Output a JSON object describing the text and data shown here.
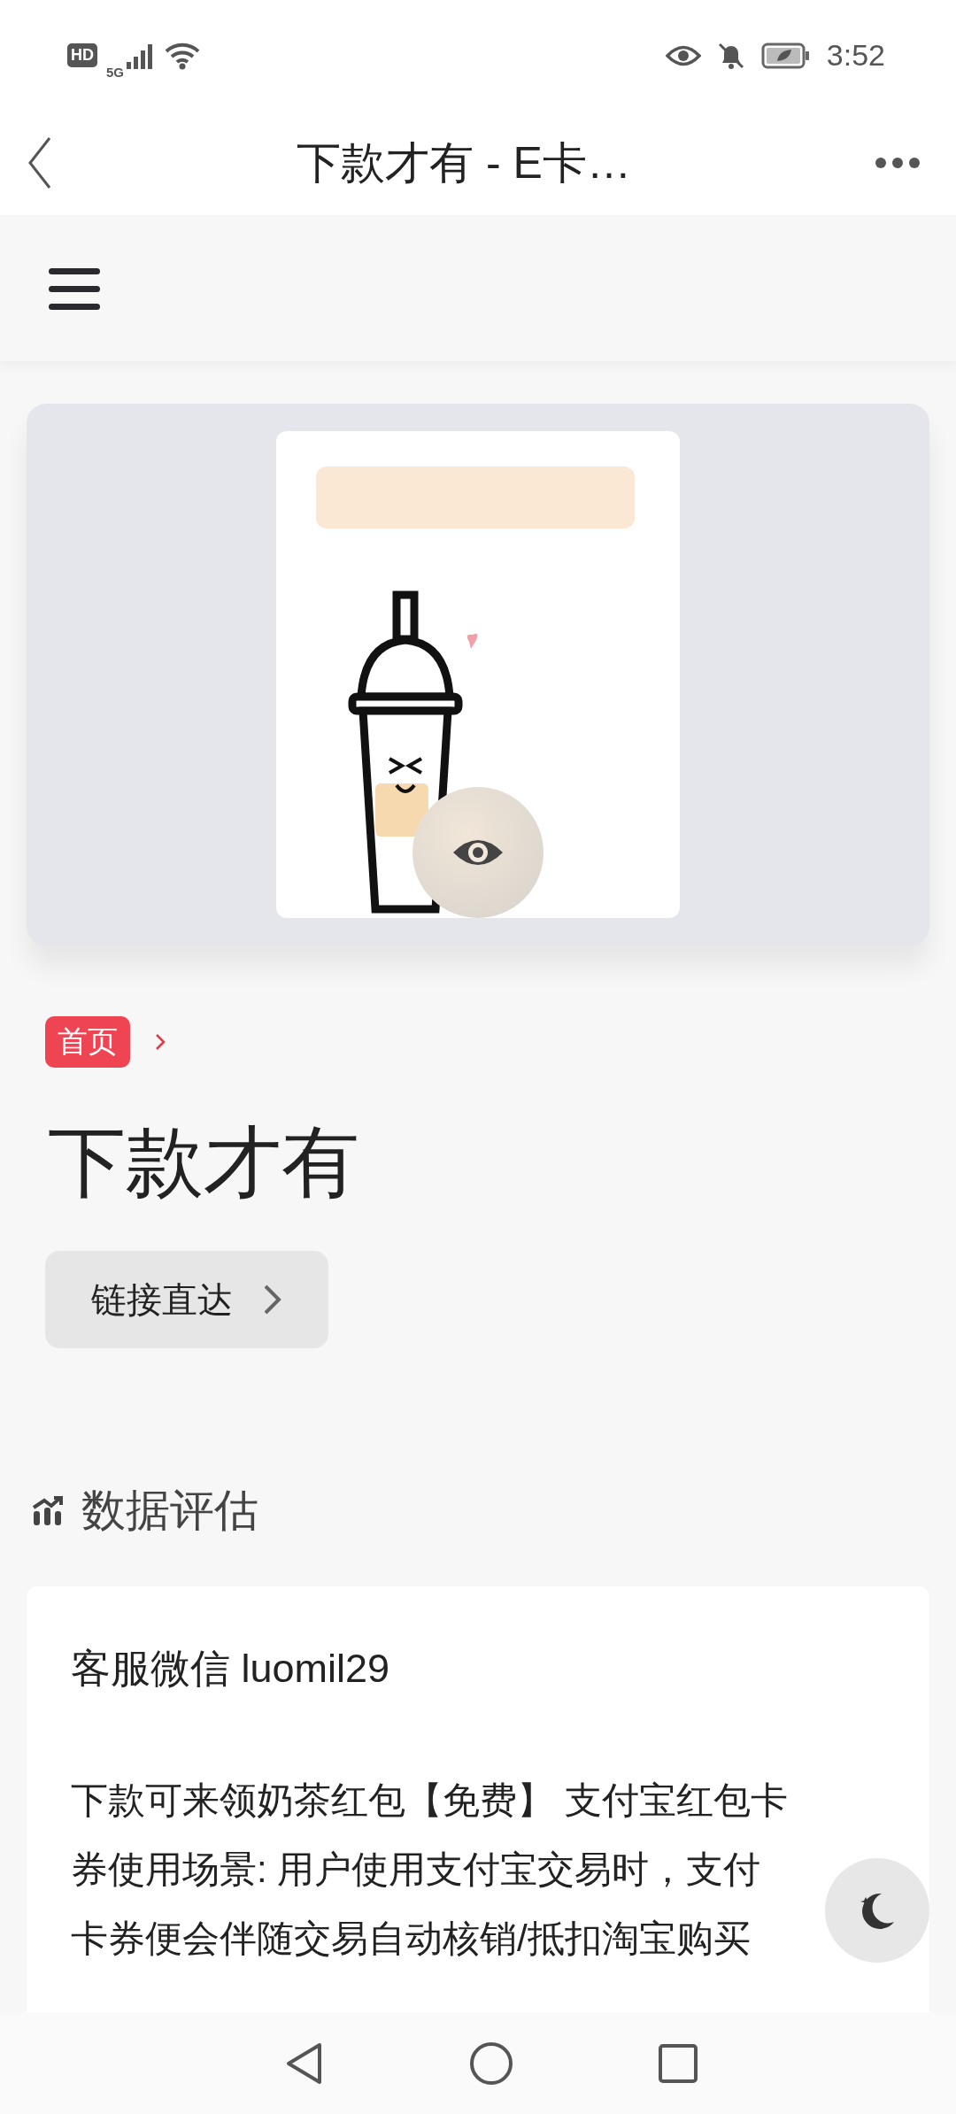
{
  "status_bar": {
    "hd": "HD",
    "network": "5G",
    "time": "3:52"
  },
  "nav": {
    "title": "下款才有 - E卡…"
  },
  "breadcrumb": [
    {
      "label": "首页"
    }
  ],
  "page_title": "下款才有",
  "link_button": {
    "label": "链接直达"
  },
  "section": {
    "title": "数据评估"
  },
  "content": {
    "contact": "客服微信 luomil29",
    "paragraph": "下款可来领奶茶红包【免费】 支付宝红包卡券使用场景: 用户使用支付宝交易时，支付卡券便会伴随交易自动核销/抵扣淘宝购买"
  }
}
